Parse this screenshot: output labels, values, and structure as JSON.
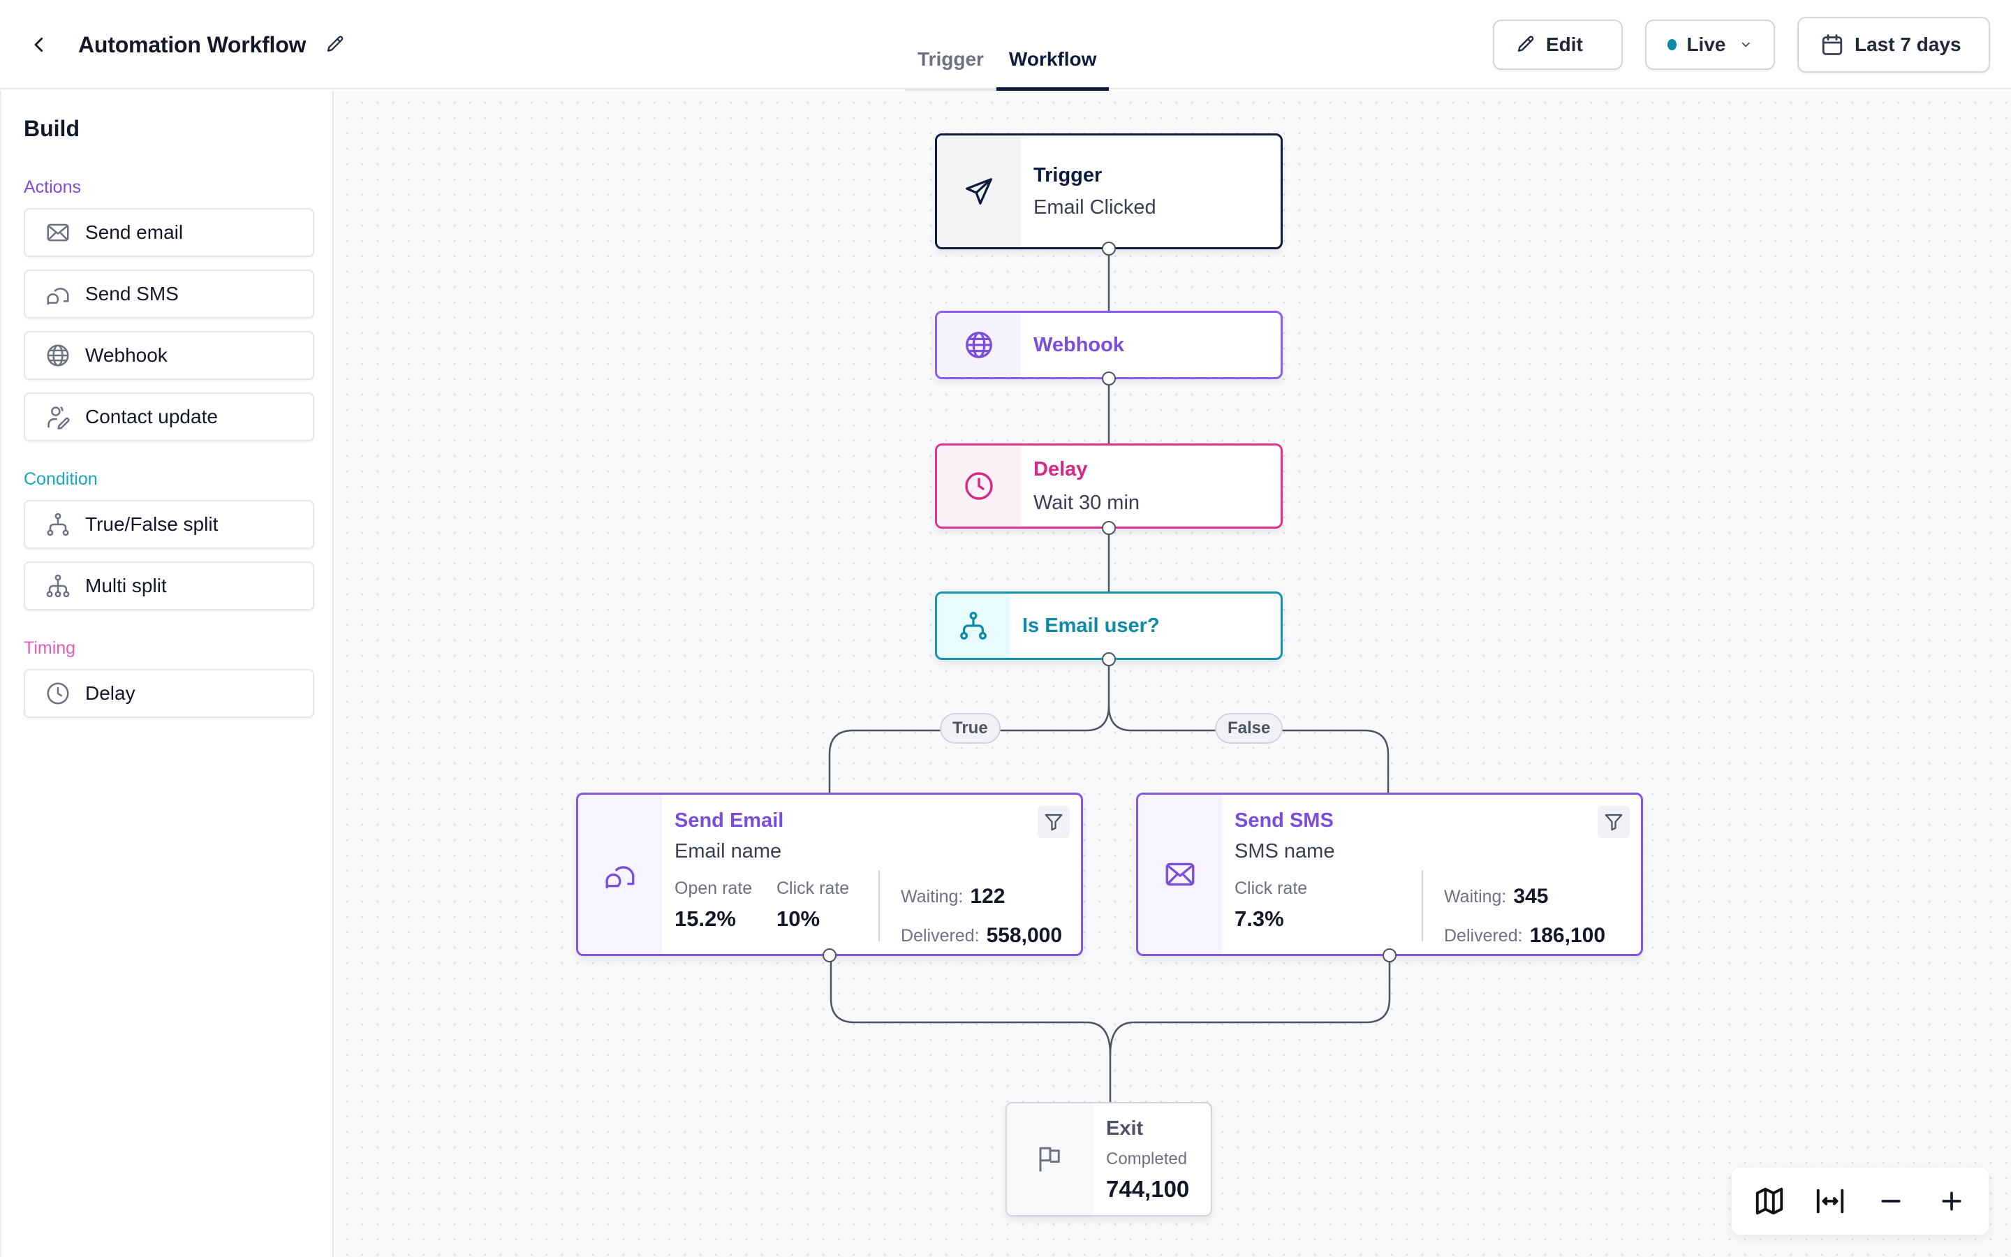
{
  "header": {
    "title": "Automation Workflow",
    "tabs": [
      {
        "label": "Trigger",
        "active": false
      },
      {
        "label": "Workflow",
        "active": true
      }
    ],
    "edit_label": "Edit",
    "status_label": "Live",
    "status_color": "#0e8aa8",
    "date_range_label": "Last 7 days"
  },
  "sidebar": {
    "title": "Build",
    "sections": [
      {
        "label": "Actions",
        "color": "#7c4ddb",
        "items": [
          {
            "label": "Send email",
            "icon": "mail-icon"
          },
          {
            "label": "Send SMS",
            "icon": "chat-bubbles-icon"
          },
          {
            "label": "Webhook",
            "icon": "globe-icon"
          },
          {
            "label": "Contact update",
            "icon": "user-edit-icon"
          }
        ]
      },
      {
        "label": "Condition",
        "color": "#17a7c4",
        "items": [
          {
            "label": "True/False split",
            "icon": "branch-split-icon"
          },
          {
            "label": "Multi split",
            "icon": "multi-split-icon"
          }
        ]
      },
      {
        "label": "Timing",
        "color": "#e25bb7",
        "items": [
          {
            "label": "Delay",
            "icon": "clock-icon"
          }
        ]
      }
    ]
  },
  "workflow": {
    "trigger": {
      "title": "Trigger",
      "subtitle": "Email Clicked",
      "color": "#0f1b3d"
    },
    "webhook": {
      "title": "Webhook",
      "color": "#7c4ddb"
    },
    "delay": {
      "title": "Delay",
      "subtitle": "Wait 30 min",
      "color": "#d72683"
    },
    "condition": {
      "title": "Is Email user?",
      "color": "#0e8aa8"
    },
    "branches": {
      "true_label": "True",
      "false_label": "False"
    },
    "send_email": {
      "title": "Send Email",
      "subtitle": "Email name",
      "metrics": [
        {
          "label": "Open rate",
          "value": "15.2%"
        },
        {
          "label": "Click rate",
          "value": "10%"
        }
      ],
      "waiting_label": "Waiting:",
      "waiting_value": "122",
      "delivered_label": "Delivered:",
      "delivered_value": "558,000"
    },
    "send_sms": {
      "title": "Send SMS",
      "subtitle": "SMS name",
      "metrics": [
        {
          "label": "Click rate",
          "value": "7.3%"
        }
      ],
      "waiting_label": "Waiting:",
      "waiting_value": "345",
      "delivered_label": "Delivered:",
      "delivered_value": "186,100"
    },
    "exit": {
      "title": "Exit",
      "label": "Completed",
      "value": "744,100"
    }
  },
  "zoom_controls": [
    "minimap-icon",
    "fit-width-icon",
    "zoom-out-icon",
    "zoom-in-icon"
  ]
}
